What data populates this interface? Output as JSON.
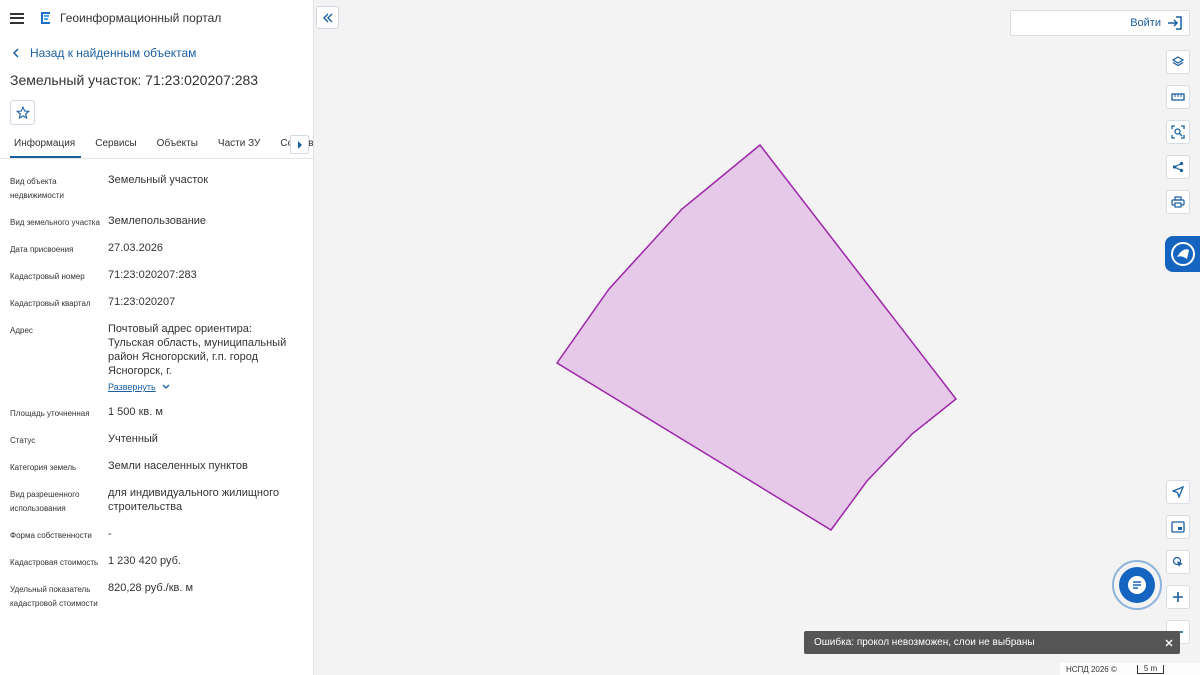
{
  "app": {
    "title": "Геоинформационный портал"
  },
  "nav": {
    "back_label": "Назад к найденным объектам"
  },
  "object": {
    "title": "Земельный участок: 71:23:020207:283"
  },
  "tabs": [
    {
      "label": "Информация",
      "active": true
    },
    {
      "label": "Сервисы",
      "active": false
    },
    {
      "label": "Объекты",
      "active": false
    },
    {
      "label": "Части ЗУ",
      "active": false
    },
    {
      "label": "Состав",
      "active": false
    }
  ],
  "properties": [
    {
      "label": "Вид объекта недвижимости",
      "value": "Земельный участок"
    },
    {
      "label": "Вид земельного участка",
      "value": "Землепользование"
    },
    {
      "label": "Дата присвоения",
      "value": "27.03.2026"
    },
    {
      "label": "Кадастровый номер",
      "value": "71:23:020207:283"
    },
    {
      "label": "Кадастровый квартал",
      "value": "71:23:020207"
    },
    {
      "label": "Адрес",
      "value": "Почтовый адрес ориентира: Тульская область, муниципальный район Ясногорский, г.п. город Ясногорск, г.",
      "expand_label": "Развернуть"
    },
    {
      "label": "Площадь уточненная",
      "value": "1 500 кв. м"
    },
    {
      "label": "Статус",
      "value": "Учтенный"
    },
    {
      "label": "Категория земель",
      "value": "Земли населенных пунктов"
    },
    {
      "label": "Вид разрешенного использования",
      "value": "для индивидуального жилищного строительства"
    },
    {
      "label": "Форма собственности",
      "value": "-"
    },
    {
      "label": "Кадастровая стоимость",
      "value": "1 230 420 руб."
    },
    {
      "label": "Удельный показатель кадастровой стоимости",
      "value": "820,28 руб./кв. м"
    }
  ],
  "header": {
    "login_label": "Войти"
  },
  "map": {
    "parcel_fill": "#e6c9e8",
    "parcel_stroke": "#9b27a8",
    "accent": "#1565c0"
  },
  "toast": {
    "message": "Ошибка: прокол невозможен, слои не выбраны"
  },
  "footer": {
    "copyright": "НСПД 2026 ©",
    "scale_label": "5 m"
  },
  "icons": {
    "menu": "hamburger-icon",
    "logo": "portal-logo-icon",
    "back": "chevron-left-icon",
    "favorite": "star-icon",
    "tabs_next": "chevron-right-icon",
    "expand": "chevron-down-icon",
    "collapse": "double-chevron-left-icon",
    "login": "login-icon",
    "tools": [
      "layers-icon",
      "ruler-icon",
      "select-area-icon",
      "share-icon",
      "print-icon",
      "navigate-icon",
      "minimap-icon",
      "locate-icon",
      "zoom-in-icon",
      "zoom-out-icon"
    ],
    "help": "help-icon",
    "chat": "chat-icon",
    "close": "close-icon"
  }
}
